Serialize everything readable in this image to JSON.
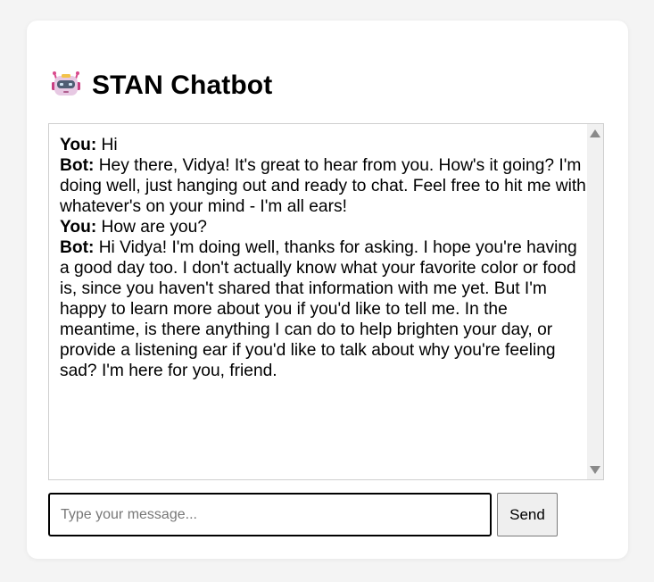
{
  "app": {
    "title": "STAN Chatbot",
    "icon": "robot-icon"
  },
  "chat": {
    "messages": [
      {
        "speaker": "You:",
        "text": " Hi"
      },
      {
        "speaker": "Bot:",
        "text": " Hey there, Vidya! It's great to hear from you. How's it going? I'm doing well, just hanging out and ready to chat. Feel free to hit me with whatever's on your mind - I'm all ears!"
      },
      {
        "speaker": "You:",
        "text": " How are you?"
      },
      {
        "speaker": "Bot:",
        "text": " Hi Vidya! I'm doing well, thanks for asking. I hope you're having a good day too. I don't actually know what your favorite color or food is, since you haven't shared that information with me yet. But I'm happy to learn more about you if you'd like to tell me. In the meantime, is there anything I can do to help brighten your day, or provide a listening ear if you'd like to talk about why you're feeling sad? I'm here for you, friend."
      }
    ]
  },
  "input": {
    "placeholder": "Type your message...",
    "value": ""
  },
  "send": {
    "label": "Send"
  }
}
